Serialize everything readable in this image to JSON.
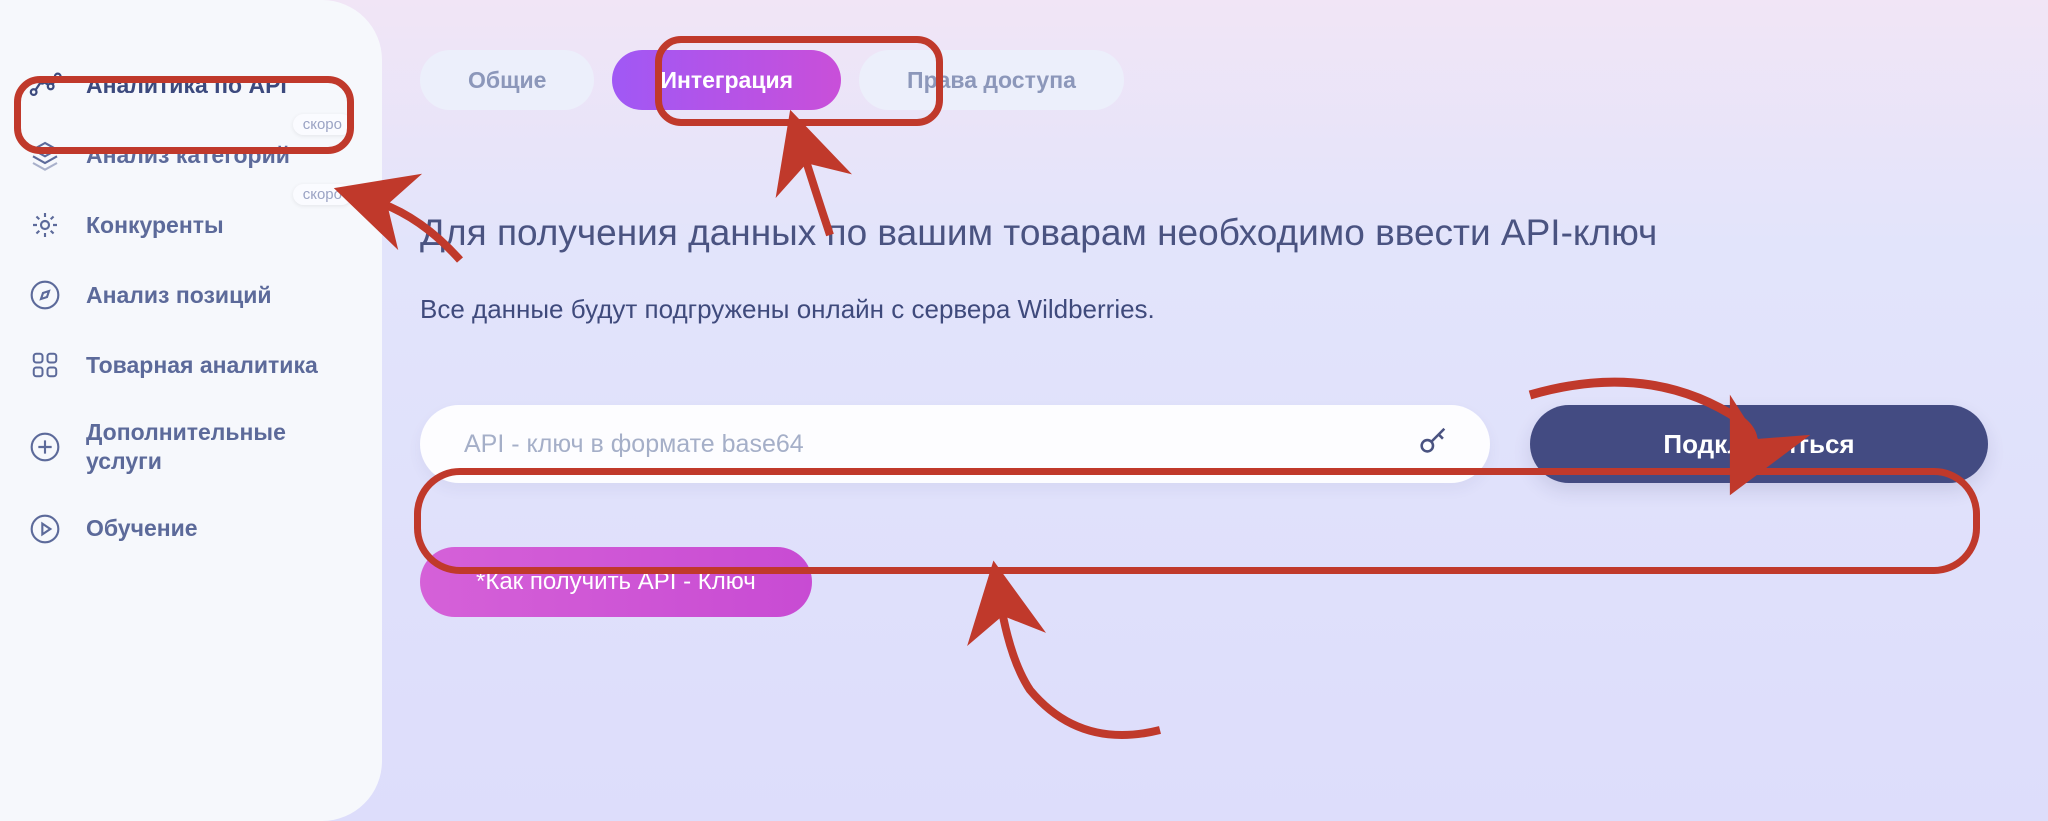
{
  "sidebar": {
    "items": [
      {
        "label": "Аналитика по API",
        "badge": null
      },
      {
        "label": "Анализ категорий",
        "badge": "скоро"
      },
      {
        "label": "Конкуренты",
        "badge": "скоро"
      },
      {
        "label": "Анализ позиций",
        "badge": null
      },
      {
        "label": "Товарная аналитика",
        "badge": null
      },
      {
        "label": "Дополнительные услуги",
        "badge": null
      },
      {
        "label": "Обучение",
        "badge": null
      }
    ]
  },
  "tabs": {
    "general": "Общие",
    "integration": "Интеграция",
    "access": "Права доступа"
  },
  "content": {
    "heading": "Для получения данных по вашим товарам необходимо ввести API-ключ",
    "subheading": "Все данные будут подгружены онлайн с сервера Wildberries.",
    "input_placeholder": "API - ключ в формате base64",
    "connect_btn": "Подключиться",
    "help_btn": "*Как получить API - Ключ"
  }
}
